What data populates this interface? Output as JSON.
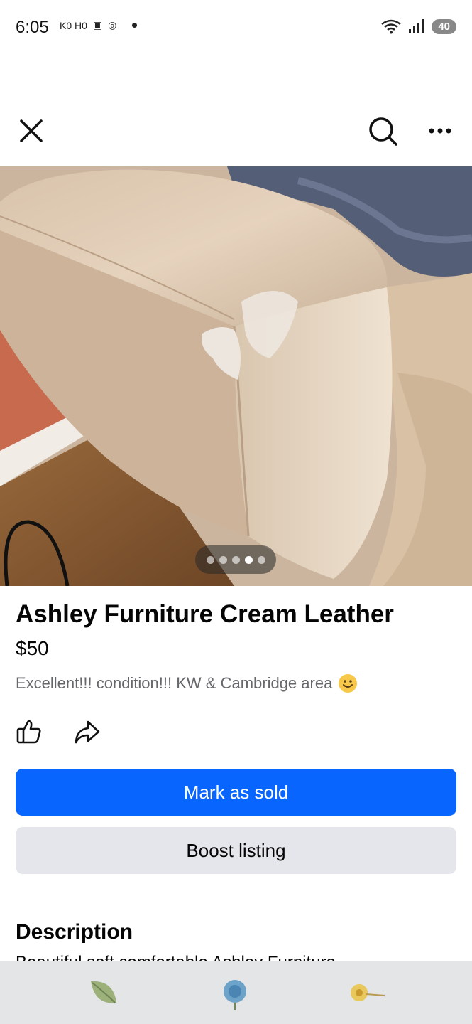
{
  "status_bar": {
    "time": "6:05",
    "left_glyphs": [
      "K0 H0",
      "▣",
      "◎"
    ],
    "battery": "40"
  },
  "toolbar": {
    "close_icon": "close-icon",
    "search_icon": "search-icon",
    "more_icon": "more-horizontal-icon"
  },
  "photo": {
    "description_icon": "product-photo",
    "carousel": {
      "count": 5,
      "active_index": 3
    }
  },
  "listing": {
    "title": "Ashley Furniture Cream Leather",
    "price": "$50",
    "subtitle": "Excellent!!! condition!!! KW & Cambridge area",
    "emoji": "smiling-face-emoji"
  },
  "actions": {
    "like_icon": "thumbs-up-icon",
    "share_icon": "share-icon"
  },
  "buttons": {
    "mark_sold": "Mark as sold",
    "boost": "Boost listing"
  },
  "description": {
    "heading": "Description",
    "peek_text": "Beautiful soft comfortable Ashley Furniture"
  },
  "colors": {
    "primary": "#0866ff",
    "secondary_button": "#e4e6eb",
    "muted_text": "#65676b"
  }
}
